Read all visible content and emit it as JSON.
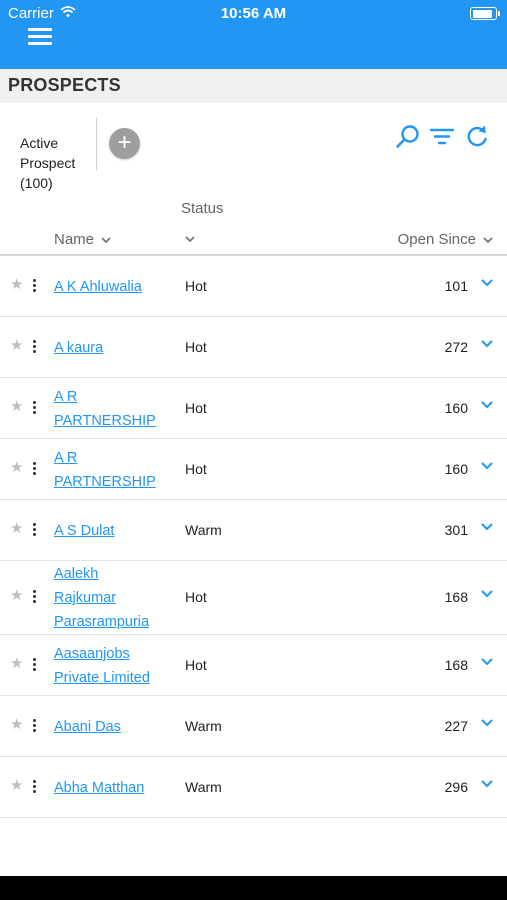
{
  "status_bar": {
    "carrier": "Carrier",
    "time": "10:56 AM"
  },
  "page": {
    "title": "PROSPECTS"
  },
  "toolbar": {
    "active_line1": "Active",
    "active_line2": "Prospect",
    "active_line3": "(100)",
    "add_symbol": "+"
  },
  "columns": {
    "status": "Status",
    "name": "Name",
    "open_since": "Open Since"
  },
  "colors": {
    "accent": "#2196f3",
    "link": "#2196f3",
    "add_button": "#9e9e9e"
  },
  "icons": [
    "wifi-icon",
    "battery-icon",
    "menu-icon",
    "search-icon",
    "filter-icon",
    "refresh-icon",
    "star-icon",
    "more-vertical-icon",
    "chevron-down-icon"
  ],
  "rows": [
    {
      "name_lines": [
        "A K Ahluwalia"
      ],
      "status": "Hot",
      "open_since": "101"
    },
    {
      "name_lines": [
        "A kaura"
      ],
      "status": "Hot",
      "open_since": "272"
    },
    {
      "name_lines": [
        "A R",
        "PARTNERSHIP"
      ],
      "status": "Hot",
      "open_since": "160"
    },
    {
      "name_lines": [
        "A R",
        "PARTNERSHIP"
      ],
      "status": "Hot",
      "open_since": "160"
    },
    {
      "name_lines": [
        "A S Dulat"
      ],
      "status": "Warm",
      "open_since": "301"
    },
    {
      "name_lines": [
        "Aalekh",
        "Rajkumar",
        "Parasrampuria"
      ],
      "status": "Hot",
      "open_since": "168"
    },
    {
      "name_lines": [
        "Aasaanjobs",
        "Private Limited"
      ],
      "status": "Hot",
      "open_since": "168"
    },
    {
      "name_lines": [
        "Abani Das"
      ],
      "status": "Warm",
      "open_since": "227"
    },
    {
      "name_lines": [
        "Abha Matthan"
      ],
      "status": "Warm",
      "open_since": "296"
    }
  ]
}
